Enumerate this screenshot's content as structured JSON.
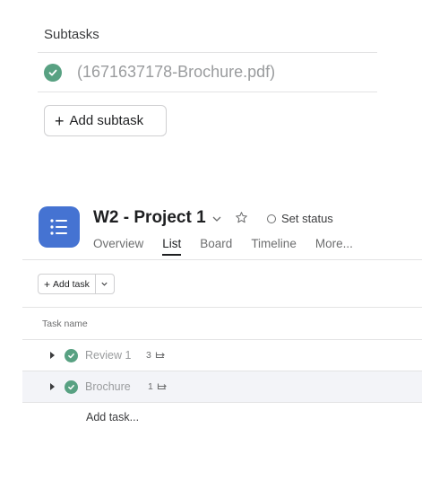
{
  "subtasks": {
    "header": "Subtasks",
    "items": [
      {
        "name": "(1671637178-Brochure.pdf)",
        "completed": true
      }
    ],
    "add_button_label": "Add subtask"
  },
  "project": {
    "title": "W2 - Project 1",
    "set_status_label": "Set status",
    "tabs": [
      "Overview",
      "List",
      "Board",
      "Timeline",
      "More..."
    ],
    "active_tab": "List"
  },
  "toolbar": {
    "add_task_label": "Add task"
  },
  "list": {
    "column_header": "Task name",
    "tasks": [
      {
        "name": "Review 1",
        "subtask_count": "3",
        "completed": true
      },
      {
        "name": "Brochure",
        "subtask_count": "1",
        "completed": true
      }
    ],
    "add_task_inline": "Add task..."
  },
  "colors": {
    "complete_green": "#58a182",
    "project_icon_blue": "#4573d2",
    "row_highlight": "#f3f4f8"
  }
}
